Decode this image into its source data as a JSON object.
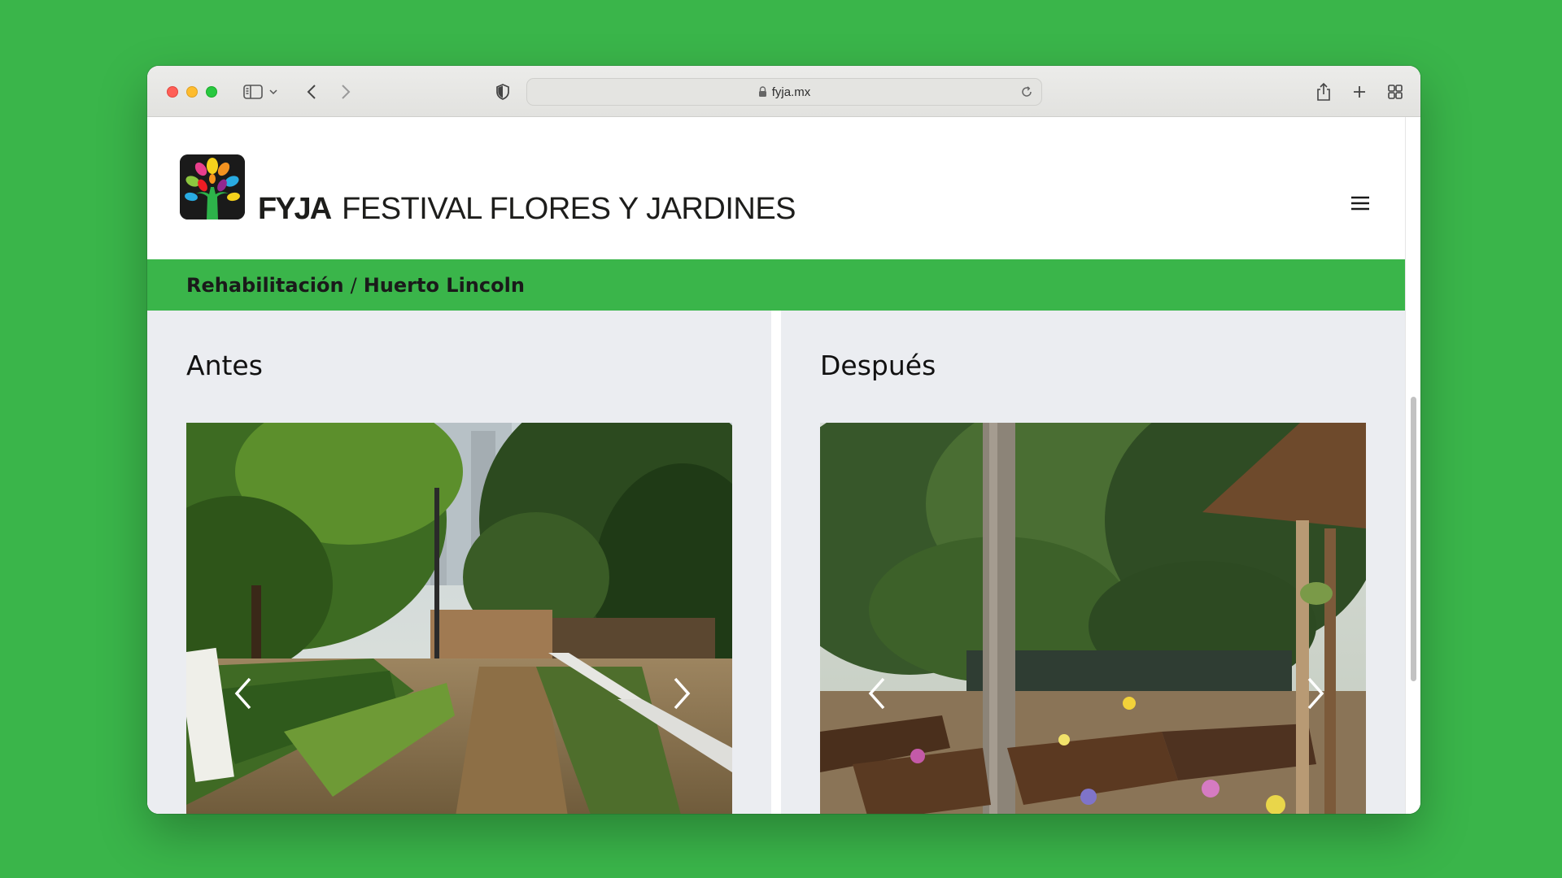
{
  "browser": {
    "url": "fyja.mx"
  },
  "site": {
    "logo_abbr": "FYJA",
    "logo_full": "FESTIVAL FLORES Y JARDINES"
  },
  "breadcrumb": {
    "section": "Rehabilitación",
    "separator": "/",
    "page": "Huerto Lincoln"
  },
  "panels": {
    "before": {
      "title": "Antes"
    },
    "after": {
      "title": "Después"
    }
  },
  "colors": {
    "brand_green": "#3ab54a",
    "panel_bg": "#ebedf1"
  },
  "icons": {
    "toolbar": [
      "sidebar-icon",
      "chevron-down-icon",
      "back-arrow-icon",
      "forward-arrow-icon",
      "shield-icon",
      "lock-icon",
      "reload-icon",
      "share-icon",
      "plus-icon",
      "tab-overview-icon"
    ],
    "page": [
      "hamburger-menu-icon",
      "chevron-left-icon",
      "chevron-right-icon"
    ]
  }
}
